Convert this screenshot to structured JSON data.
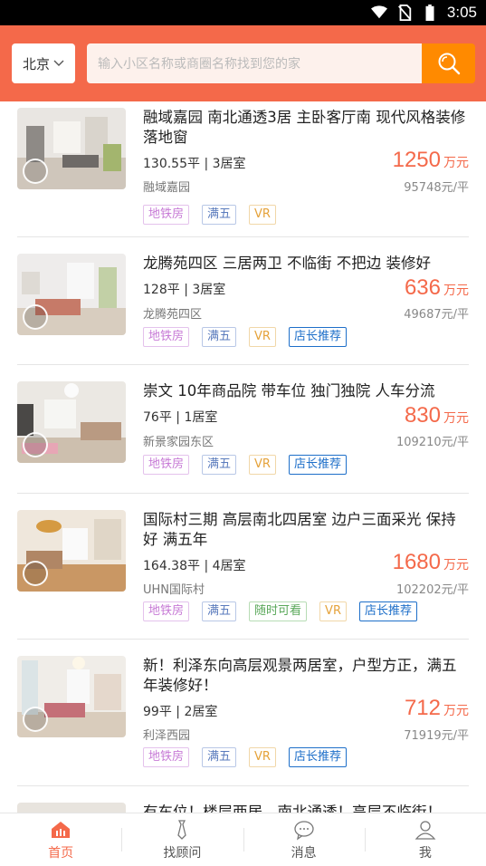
{
  "status_bar": {
    "time": "3:05"
  },
  "header": {
    "city": "北京",
    "search_placeholder": "输入小区名称或商圈名称找到您的家",
    "search_icon": "search-icon"
  },
  "colors": {
    "accent": "#f4694a",
    "search_button": "#ff8a00",
    "price": "#f4694a",
    "recommend_tag": "#1e6fc9"
  },
  "listings": [
    {
      "title": "融域嘉园 南北通透3居 主卧客厅南 现代风格装修落地窗",
      "area": "130.55平",
      "rooms": "3居室",
      "community": "融域嘉园",
      "price": "1250",
      "price_unit": "万元",
      "unit_price": "95748元/平",
      "tags": [
        "地铁房",
        "满五",
        "VR"
      ]
    },
    {
      "title": "龙腾苑四区 三居两卫 不临街 不把边 装修好",
      "area": "128平",
      "rooms": "3居室",
      "community": "龙腾苑四区",
      "price": "636",
      "price_unit": "万元",
      "unit_price": "49687元/平",
      "tags": [
        "地铁房",
        "满五",
        "VR",
        "店长推荐"
      ]
    },
    {
      "title": "崇文 10年商品院 带车位 独门独院 人车分流",
      "area": "76平",
      "rooms": "1居室",
      "community": "新景家园东区",
      "price": "830",
      "price_unit": "万元",
      "unit_price": "109210元/平",
      "tags": [
        "地铁房",
        "满五",
        "VR",
        "店长推荐"
      ]
    },
    {
      "title": "国际村三期 高层南北四居室 边户三面采光 保持好 满五年",
      "area": "164.38平",
      "rooms": "4居室",
      "community": "UHN国际村",
      "price": "1680",
      "price_unit": "万元",
      "unit_price": "102202元/平",
      "tags": [
        "地铁房",
        "满五",
        "随时可看",
        "VR",
        "店长推荐"
      ]
    },
    {
      "title": "新！利泽东向高层观景两居室，户型方正，满五年装修好！",
      "area": "99平",
      "rooms": "2居室",
      "community": "利泽西园",
      "price": "712",
      "price_unit": "万元",
      "unit_price": "71919元/平",
      "tags": [
        "地铁房",
        "满五",
        "VR",
        "店长推荐"
      ]
    },
    {
      "title": "有车位！楼层两居，南北通透！高层不临街！",
      "partial": true
    }
  ],
  "tabbar": {
    "items": [
      {
        "label": "首页",
        "icon": "home-icon",
        "active": true
      },
      {
        "label": "找顾问",
        "icon": "tie-icon",
        "active": false
      },
      {
        "label": "消息",
        "icon": "message-icon",
        "active": false
      },
      {
        "label": "我",
        "icon": "user-icon",
        "active": false
      }
    ]
  }
}
